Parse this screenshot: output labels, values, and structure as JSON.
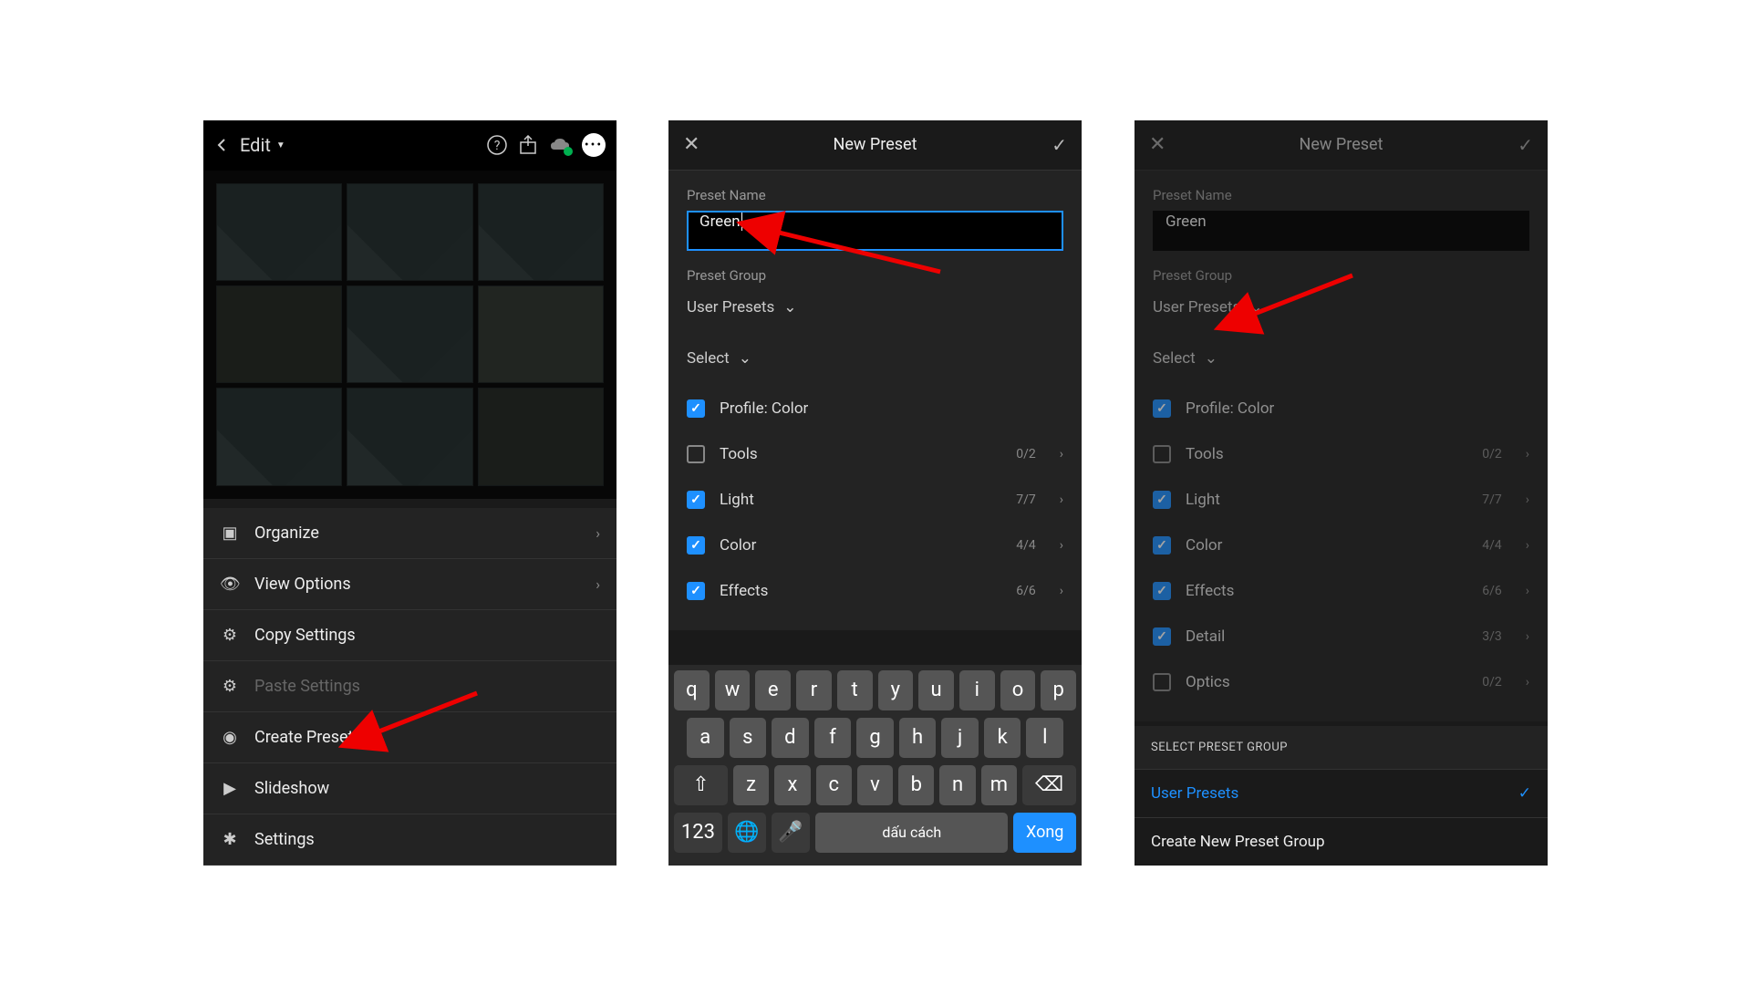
{
  "panel1": {
    "edit_label": "Edit",
    "menu": {
      "organize": "Organize",
      "view_options": "View Options",
      "copy_settings": "Copy Settings",
      "paste_settings": "Paste Settings",
      "create_preset": "Create Preset",
      "slideshow": "Slideshow",
      "settings": "Settings"
    }
  },
  "panel2": {
    "title": "New Preset",
    "preset_name_label": "Preset Name",
    "preset_name_value": "Green",
    "preset_group_label": "Preset Group",
    "preset_group_value": "User Presets",
    "select_label": "Select",
    "options": {
      "profile": "Profile: Color",
      "tools": "Tools",
      "tools_count": "0/2",
      "light": "Light",
      "light_count": "7/7",
      "color": "Color",
      "color_count": "4/4",
      "effects": "Effects",
      "effects_count": "6/6"
    },
    "keyboard": {
      "space_label": "dấu cách",
      "done_label": "Xong",
      "num_label": "123"
    }
  },
  "panel3": {
    "title": "New Preset",
    "preset_name_label": "Preset Name",
    "preset_name_value": "Green",
    "preset_group_label": "Preset Group",
    "preset_group_value": "User Presets",
    "select_label": "Select",
    "options": {
      "profile": "Profile: Color",
      "tools": "Tools",
      "tools_count": "0/2",
      "light": "Light",
      "light_count": "7/7",
      "color": "Color",
      "color_count": "4/4",
      "effects": "Effects",
      "effects_count": "6/6",
      "detail": "Detail",
      "detail_count": "3/3",
      "optics": "Optics",
      "optics_count": "0/2"
    },
    "group_section": {
      "header": "SELECT PRESET GROUP",
      "selected": "User Presets",
      "create_new": "Create New Preset Group"
    }
  }
}
